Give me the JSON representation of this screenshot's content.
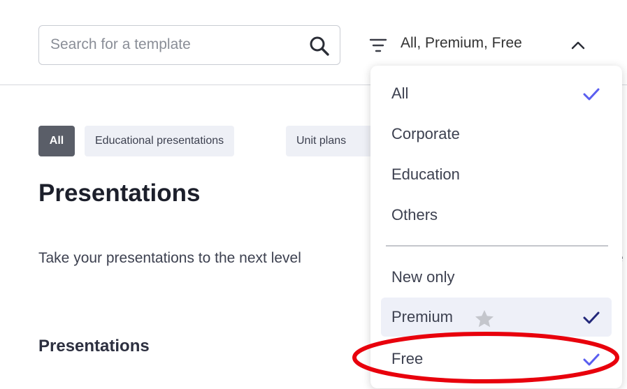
{
  "search": {
    "placeholder": "Search for a template",
    "value": ""
  },
  "filter": {
    "label": "All, Premium, Free"
  },
  "chips": [
    {
      "label": "All",
      "selected": true
    },
    {
      "label": "Educational presentations",
      "selected": false
    },
    {
      "label": "Unit plans",
      "selected": false
    }
  ],
  "page": {
    "title": "Presentations",
    "description": "Take your presentations to the next level",
    "description_tail": "e",
    "section_title": "Presentations"
  },
  "dropdown": {
    "items": [
      {
        "label": "All",
        "checked": true
      },
      {
        "label": "Corporate",
        "checked": false
      },
      {
        "label": "Education",
        "checked": false
      },
      {
        "label": "Others",
        "checked": false
      },
      {
        "label": "New only",
        "checked": false
      },
      {
        "label": "Premium",
        "checked": true,
        "icon": "star-icon"
      },
      {
        "label": "Free",
        "checked": true
      }
    ]
  },
  "colors": {
    "check_blue": "#5a5ef0",
    "check_dark": "#23287a",
    "annotation_red": "#e8000c",
    "chip_selected": "#5a5e68"
  }
}
